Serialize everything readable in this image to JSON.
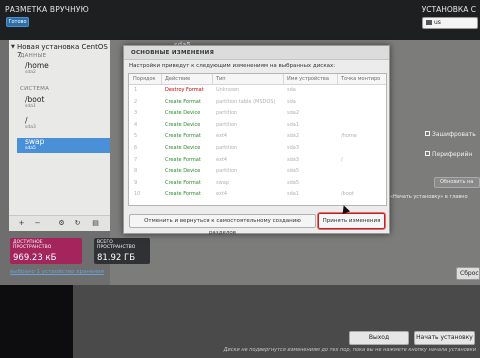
{
  "header": {
    "title": "РАЗМЕТКА ВРУЧНУЮ",
    "done_label": "Готово",
    "install_title": "УСТАНОВКА C",
    "keyboard_layout": "us"
  },
  "tree": {
    "title": "Новая установка CentOS 7",
    "sections": [
      {
        "label": "ДАННЫЕ",
        "items": [
          {
            "mount": "/home",
            "device": "sda2",
            "selected": false
          }
        ]
      },
      {
        "label": "СИСТЕМА",
        "items": [
          {
            "mount": "/boot",
            "device": "sda1",
            "selected": false
          },
          {
            "mount": "/",
            "device": "sda3",
            "selected": false
          },
          {
            "mount": "swap",
            "device": "sda5",
            "selected": true
          }
        ]
      }
    ],
    "tools": [
      "+",
      "−",
      "⚙",
      "↻",
      "▤"
    ]
  },
  "space": {
    "available_label": "ДОСТУПНОЕ ПРОСТРАНСТВО",
    "available_value": "969.23 кБ",
    "total_label": "ВСЕГО ПРОСТРАНСТВО",
    "total_value": "81.92 ГБ",
    "storage_link": "выбрано 1 устройство хранения"
  },
  "right": {
    "selected_device": "sda5",
    "encrypt_label": "Зашифровать",
    "perf_label": "Периферийн",
    "refresh_label": "Обновить на",
    "hint": "«Начать установку» в главно",
    "reset_label": "Сброс"
  },
  "footer": {
    "exit_label": "Выход",
    "start_label": "Начать установку",
    "note": "Диски не подвергнутся изменениям до тех пор, пока вы не нажмете кнопку начала установки"
  },
  "modal": {
    "title": "ОСНОВНЫЕ ИЗМЕНЕНИЯ",
    "description": "Настройки приведут к следующим изменениям на выбранных дисках:",
    "columns": [
      "Порядок",
      "Действие",
      "Тип",
      "Имя устройства",
      "Точка монтиро"
    ],
    "rows": [
      {
        "order": "1",
        "action": "Destroy Format",
        "kind": "destroy",
        "type": "Unknown",
        "device": "sda",
        "mount": ""
      },
      {
        "order": "2",
        "action": "Create Format",
        "kind": "create",
        "type": "partition table (MSDOS)",
        "device": "sda",
        "mount": ""
      },
      {
        "order": "3",
        "action": "Create Device",
        "kind": "create",
        "type": "partition",
        "device": "sda2",
        "mount": ""
      },
      {
        "order": "4",
        "action": "Create Device",
        "kind": "create",
        "type": "partition",
        "device": "sda1",
        "mount": ""
      },
      {
        "order": "5",
        "action": "Create Format",
        "kind": "create",
        "type": "ext4",
        "device": "sda2",
        "mount": "/home"
      },
      {
        "order": "6",
        "action": "Create Device",
        "kind": "create",
        "type": "partition",
        "device": "sda3",
        "mount": ""
      },
      {
        "order": "7",
        "action": "Create Format",
        "kind": "create",
        "type": "ext4",
        "device": "sda3",
        "mount": "/"
      },
      {
        "order": "8",
        "action": "Create Device",
        "kind": "create",
        "type": "partition",
        "device": "sda5",
        "mount": ""
      },
      {
        "order": "9",
        "action": "Create Format",
        "kind": "create",
        "type": "swap",
        "device": "sda5",
        "mount": ""
      },
      {
        "order": "10",
        "action": "Create Format",
        "kind": "create",
        "type": "ext4",
        "device": "sda1",
        "mount": "/boot"
      }
    ],
    "cancel_label": "Отменить и вернуться к самостоятельному созданию разделов",
    "accept_label": "Принять изменения"
  },
  "colors": {
    "accent": "#4a90d9",
    "destroy": "#cc0000",
    "create": "#2a8a2a",
    "available_bg": "#a3255b",
    "total_bg": "#303134"
  }
}
